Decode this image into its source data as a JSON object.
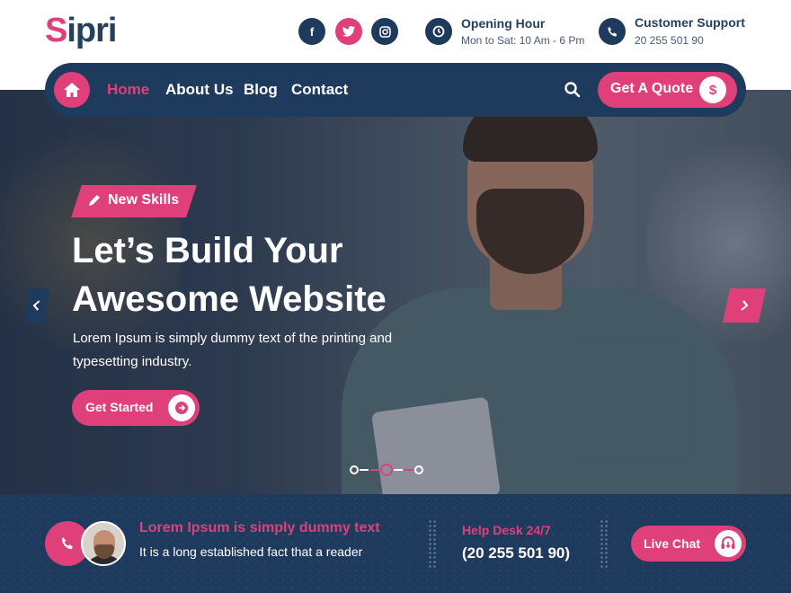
{
  "brand": {
    "logo_first": "S",
    "logo_rest": "ipri"
  },
  "header": {
    "social": [
      "facebook-icon",
      "twitter-icon",
      "instagram-icon"
    ],
    "opening": {
      "title": "Opening Hour",
      "value": "Mon to Sat: 10 Am - 6 Pm"
    },
    "support": {
      "title": "Customer Support",
      "value": "20 255 501 90"
    }
  },
  "nav": {
    "items": [
      {
        "label": "Home",
        "active": true
      },
      {
        "label": "About Us",
        "active": false
      },
      {
        "label": "Blog",
        "active": false
      },
      {
        "label": "Contact",
        "active": false
      }
    ],
    "quote_label": "Get A Quote",
    "quote_icon": "$"
  },
  "hero": {
    "tag": "New Skills",
    "headline_line1": "Let’s Build Your",
    "headline_line2": "Awesome Website",
    "description": "Lorem Ipsum is simply dummy text of the printing and typesetting industry.",
    "cta_label": "Get Started",
    "slides_count": 3,
    "active_slide": 2
  },
  "bottom": {
    "title": "Lorem Ipsum is simply dummy text",
    "subtitle": "It is a long established fact that a reader",
    "help_title": "Help Desk 24/7",
    "help_number": "(20 255 501 90)",
    "chat_label": "Live Chat"
  },
  "colors": {
    "accent": "#e0407a",
    "navy": "#1e3a5c"
  }
}
